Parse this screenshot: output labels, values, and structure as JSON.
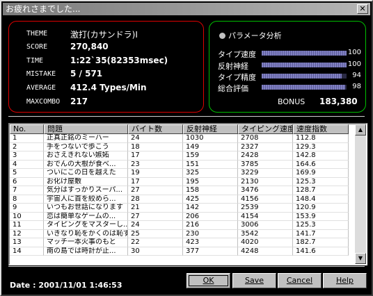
{
  "window": {
    "title": "お疲れさまでした..."
  },
  "result": {
    "rows": [
      {
        "label": "THEME",
        "value": "激打(カサンドラ)Ⅰ"
      },
      {
        "label": "SCORE",
        "value": "270,840"
      },
      {
        "label": "TIME",
        "value": "1:22`35(82353msec)"
      },
      {
        "label": "MISTAKE",
        "value": "5 / 571"
      },
      {
        "label": "AVERAGE",
        "value": "412.4 Types/Min"
      },
      {
        "label": "MAXCOMBO",
        "value": "217"
      }
    ]
  },
  "parameters": {
    "heading": "パラメータ分析",
    "items": [
      {
        "label": "タイプ速度",
        "value": "100",
        "level": 100
      },
      {
        "label": "反射神経",
        "value": "100",
        "level": 100
      },
      {
        "label": "タイプ精度",
        "value": "94",
        "level": 94
      },
      {
        "label": "総合評価",
        "value": "98",
        "level": 98
      }
    ],
    "bonus_label": "BONUS",
    "bonus_value": "183,380",
    "bar_color": "#8080c0"
  },
  "table": {
    "columns": [
      "No.",
      "問題",
      "バイト数",
      "反射神経",
      "タイピング速度",
      "速度指数"
    ],
    "rows": [
      [
        "1",
        "正真正銘のミーハー",
        "24",
        "1030",
        "2708",
        "112.8"
      ],
      [
        "2",
        "手をつないで歩こう",
        "18",
        "149",
        "2327",
        "129.3"
      ],
      [
        "3",
        "おさえきれない嫉妬",
        "17",
        "159",
        "2428",
        "142.8"
      ],
      [
        "4",
        "おでんの大根が食べ...",
        "23",
        "151",
        "3785",
        "164.6"
      ],
      [
        "5",
        "ついにこの日を越えた",
        "19",
        "325",
        "3229",
        "169.9"
      ],
      [
        "6",
        "お化け屋敷",
        "17",
        "195",
        "2130",
        "125.3"
      ],
      [
        "7",
        "気分はすっかりスーパ...",
        "27",
        "158",
        "3476",
        "128.7"
      ],
      [
        "8",
        "宇宙人に首を絞めら...",
        "28",
        "425",
        "4156",
        "148.4"
      ],
      [
        "9",
        "いつもお世話になります",
        "21",
        "142",
        "2539",
        "120.9"
      ],
      [
        "10",
        "恋は簡単なゲームの...",
        "27",
        "206",
        "4154",
        "153.9"
      ],
      [
        "11",
        "タイピングをマスターし...",
        "24",
        "216",
        "3006",
        "125.3"
      ],
      [
        "12",
        "いきなり恥をかくのは恥ず...",
        "25",
        "230",
        "3542",
        "141.7"
      ],
      [
        "13",
        "マッチ一本火事のもと",
        "22",
        "423",
        "4020",
        "182.7"
      ],
      [
        "14",
        "南の島では時計が止...",
        "30",
        "377",
        "4248",
        "141.6"
      ]
    ]
  },
  "footer": {
    "date": "Date : 2001/11/01 1:46:53",
    "buttons": {
      "ok": "OK",
      "save": "Save",
      "cancel": "Cancel",
      "help": "Help"
    }
  }
}
